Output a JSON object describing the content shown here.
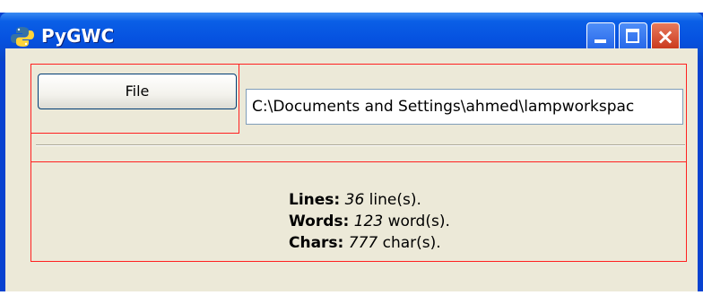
{
  "window": {
    "title": "PyGWC",
    "controls": {
      "minimize": "minimize",
      "maximize": "maximize",
      "close": "×"
    }
  },
  "file_button": {
    "label": "File"
  },
  "path_input": {
    "value": "C:\\Documents and Settings\\ahmed\\lampworkspac"
  },
  "stats": {
    "lines_label": "Lines:",
    "lines_value": "36",
    "lines_unit": "line(s).",
    "words_label": "Words:",
    "words_value": "123",
    "words_unit": "word(s).",
    "chars_label": "Chars:",
    "chars_value": "777",
    "chars_unit": "char(s)."
  },
  "colors": {
    "titlebar": "#0652e0",
    "client_bg": "#ece9d8",
    "debug_border": "#ff2020",
    "close_button": "#c8361a"
  },
  "icons": {
    "app": "python-logo-icon"
  }
}
